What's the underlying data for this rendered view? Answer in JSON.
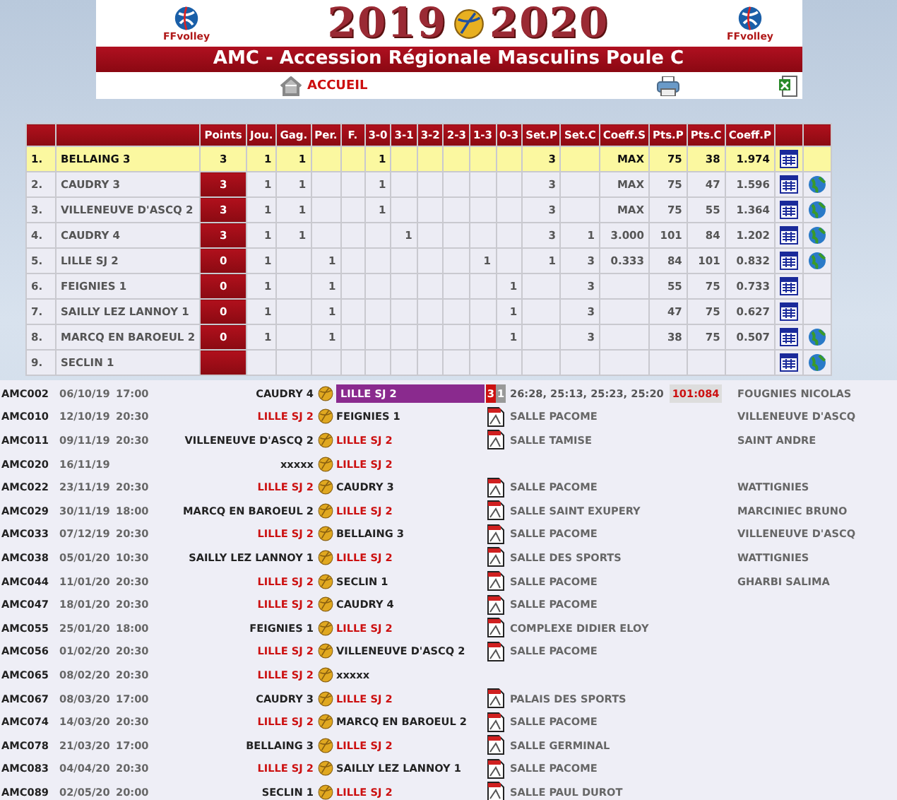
{
  "header": {
    "logo_text_left": "FFvolley",
    "logo_text_right": "FFvolley",
    "season_start": "2019",
    "season_end": "2020",
    "title": "AMC - Accession Régionale Masculins Poule C",
    "home_link": "ACCUEIL"
  },
  "standings": {
    "columns": [
      "Points",
      "Jou.",
      "Gag.",
      "Per.",
      "F.",
      "3-0",
      "3-1",
      "3-2",
      "2-3",
      "1-3",
      "0-3",
      "Set.P",
      "Set.C",
      "Coeff.S",
      "Pts.P",
      "Pts.C",
      "Coeff.P"
    ],
    "rows": [
      {
        "rank": "1.",
        "team": "BELLAING 3",
        "highlighted": true,
        "globe": false,
        "cells": [
          "3",
          "1",
          "1",
          "",
          "",
          "1",
          "",
          "",
          "",
          "",
          "",
          "3",
          "",
          "MAX",
          "75",
          "38",
          "1.974"
        ]
      },
      {
        "rank": "2.",
        "team": "CAUDRY 3",
        "highlighted": false,
        "globe": true,
        "cells": [
          "3",
          "1",
          "1",
          "",
          "",
          "1",
          "",
          "",
          "",
          "",
          "",
          "3",
          "",
          "MAX",
          "75",
          "47",
          "1.596"
        ]
      },
      {
        "rank": "3.",
        "team": "VILLENEUVE D'ASCQ 2",
        "highlighted": false,
        "globe": true,
        "cells": [
          "3",
          "1",
          "1",
          "",
          "",
          "1",
          "",
          "",
          "",
          "",
          "",
          "3",
          "",
          "MAX",
          "75",
          "55",
          "1.364"
        ]
      },
      {
        "rank": "4.",
        "team": "CAUDRY 4",
        "highlighted": false,
        "globe": true,
        "cells": [
          "3",
          "1",
          "1",
          "",
          "",
          "",
          "1",
          "",
          "",
          "",
          "",
          "3",
          "1",
          "3.000",
          "101",
          "84",
          "1.202"
        ]
      },
      {
        "rank": "5.",
        "team": "LILLE SJ 2",
        "highlighted": false,
        "globe": true,
        "cells": [
          "0",
          "1",
          "",
          "1",
          "",
          "",
          "",
          "",
          "",
          "1",
          "",
          "1",
          "3",
          "0.333",
          "84",
          "101",
          "0.832"
        ]
      },
      {
        "rank": "6.",
        "team": "FEIGNIES 1",
        "highlighted": false,
        "globe": false,
        "cells": [
          "0",
          "1",
          "",
          "1",
          "",
          "",
          "",
          "",
          "",
          "",
          "1",
          "",
          "3",
          "",
          "55",
          "75",
          "0.733"
        ]
      },
      {
        "rank": "7.",
        "team": "SAILLY LEZ LANNOY 1",
        "highlighted": false,
        "globe": false,
        "cells": [
          "0",
          "1",
          "",
          "1",
          "",
          "",
          "",
          "",
          "",
          "",
          "1",
          "",
          "3",
          "",
          "47",
          "75",
          "0.627"
        ]
      },
      {
        "rank": "8.",
        "team": "MARCQ EN BAROEUL 2",
        "highlighted": false,
        "globe": true,
        "cells": [
          "0",
          "1",
          "",
          "1",
          "",
          "",
          "",
          "",
          "",
          "",
          "1",
          "",
          "3",
          "",
          "38",
          "75",
          "0.507"
        ]
      },
      {
        "rank": "9.",
        "team": "SECLIN 1",
        "highlighted": false,
        "globe": true,
        "cells": [
          "",
          "",
          "",
          "",
          "",
          "",
          "",
          "",
          "",
          "",
          "",
          "",
          "",
          "",
          "",
          "",
          ""
        ]
      }
    ]
  },
  "matches": [
    {
      "code": "AMC002",
      "date": "06/10/19",
      "time": "17:00",
      "home": "CAUDRY 4",
      "away": "LILLE SJ 2",
      "home_highlight": false,
      "away_highlight": true,
      "result": {
        "sets_focus": "3",
        "sets_other": "1",
        "scores": "26:28, 25:13, 25:23, 25:20",
        "points": "101:084"
      },
      "note": "FOUGNIES NICOLAS"
    },
    {
      "code": "AMC010",
      "date": "12/10/19",
      "time": "20:30",
      "home": "LILLE SJ 2",
      "away": "FEIGNIES 1",
      "home_highlight": true,
      "away_highlight": false,
      "venue": "SALLE PACOME",
      "note": "VILLENEUVE D'ASCQ"
    },
    {
      "code": "AMC011",
      "date": "09/11/19",
      "time": "20:30",
      "home": "VILLENEUVE D'ASCQ 2",
      "away": "LILLE SJ 2",
      "home_highlight": false,
      "away_highlight": true,
      "venue": "SALLE TAMISE",
      "note": "SAINT ANDRE"
    },
    {
      "code": "AMC020",
      "date": "16/11/19",
      "home": "xxxxx",
      "away": "LILLE SJ 2",
      "home_highlight": false,
      "away_highlight": true
    },
    {
      "code": "AMC022",
      "date": "23/11/19",
      "time": "20:30",
      "home": "LILLE SJ 2",
      "away": "CAUDRY 3",
      "home_highlight": true,
      "away_highlight": false,
      "venue": "SALLE PACOME",
      "note": "WATTIGNIES"
    },
    {
      "code": "AMC029",
      "date": "30/11/19",
      "time": "18:00",
      "home": "MARCQ EN BAROEUL 2",
      "away": "LILLE SJ 2",
      "home_highlight": false,
      "away_highlight": true,
      "venue": "SALLE SAINT EXUPERY",
      "note": "MARCINIEC BRUNO"
    },
    {
      "code": "AMC033",
      "date": "07/12/19",
      "time": "20:30",
      "home": "LILLE SJ 2",
      "away": "BELLAING 3",
      "home_highlight": true,
      "away_highlight": false,
      "venue": "SALLE PACOME",
      "note": "VILLENEUVE D'ASCQ"
    },
    {
      "code": "AMC038",
      "date": "05/01/20",
      "time": "10:30",
      "home": "SAILLY LEZ LANNOY 1",
      "away": "LILLE SJ 2",
      "home_highlight": false,
      "away_highlight": true,
      "venue": "SALLE DES SPORTS",
      "note": "WATTIGNIES"
    },
    {
      "code": "AMC044",
      "date": "11/01/20",
      "time": "20:30",
      "home": "LILLE SJ 2",
      "away": "SECLIN 1",
      "home_highlight": true,
      "away_highlight": false,
      "venue": "SALLE PACOME",
      "note": "GHARBI SALIMA"
    },
    {
      "code": "AMC047",
      "date": "18/01/20",
      "time": "20:30",
      "home": "LILLE SJ 2",
      "away": "CAUDRY 4",
      "home_highlight": true,
      "away_highlight": false,
      "venue": "SALLE PACOME"
    },
    {
      "code": "AMC055",
      "date": "25/01/20",
      "time": "18:00",
      "home": "FEIGNIES 1",
      "away": "LILLE SJ 2",
      "home_highlight": false,
      "away_highlight": true,
      "venue": "COMPLEXE DIDIER ELOY"
    },
    {
      "code": "AMC056",
      "date": "01/02/20",
      "time": "20:30",
      "home": "LILLE SJ 2",
      "away": "VILLENEUVE D'ASCQ 2",
      "home_highlight": true,
      "away_highlight": false,
      "venue": "SALLE PACOME"
    },
    {
      "code": "AMC065",
      "date": "08/02/20",
      "time": "20:30",
      "home": "LILLE SJ 2",
      "away": "xxxxx",
      "home_highlight": true,
      "away_highlight": false
    },
    {
      "code": "AMC067",
      "date": "08/03/20",
      "time": "17:00",
      "home": "CAUDRY 3",
      "away": "LILLE SJ 2",
      "home_highlight": false,
      "away_highlight": true,
      "venue": "PALAIS DES SPORTS"
    },
    {
      "code": "AMC074",
      "date": "14/03/20",
      "time": "20:30",
      "home": "LILLE SJ 2",
      "away": "MARCQ EN BAROEUL 2",
      "home_highlight": true,
      "away_highlight": false,
      "venue": "SALLE PACOME"
    },
    {
      "code": "AMC078",
      "date": "21/03/20",
      "time": "17:00",
      "home": "BELLAING 3",
      "away": "LILLE SJ 2",
      "home_highlight": false,
      "away_highlight": true,
      "venue": "SALLE GERMINAL"
    },
    {
      "code": "AMC083",
      "date": "04/04/20",
      "time": "20:30",
      "home": "LILLE SJ 2",
      "away": "SAILLY LEZ LANNOY 1",
      "home_highlight": true,
      "away_highlight": false,
      "venue": "SALLE PACOME"
    },
    {
      "code": "AMC089",
      "date": "02/05/20",
      "time": "20:00",
      "home": "SECLIN 1",
      "away": "LILLE SJ 2",
      "home_highlight": false,
      "away_highlight": true,
      "venue": "SALLE PAUL DUROT"
    }
  ]
}
